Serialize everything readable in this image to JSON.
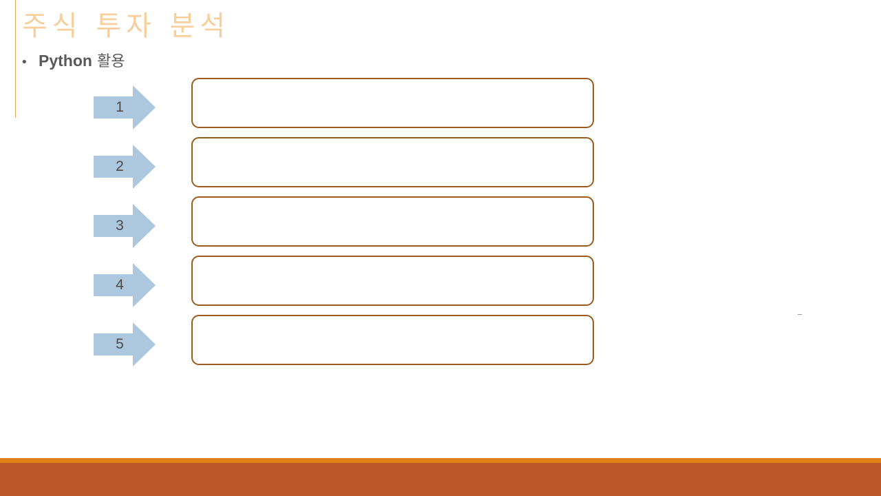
{
  "slide": {
    "title": "주식 투자 분석",
    "bullet": {
      "marker": "•",
      "bold_text": "Python",
      "rest_text": "활용"
    }
  },
  "steps": [
    {
      "number": "1",
      "text": ""
    },
    {
      "number": "2",
      "text": ""
    },
    {
      "number": "3",
      "text": ""
    },
    {
      "number": "4",
      "text": ""
    },
    {
      "number": "5",
      "text": ""
    }
  ],
  "colors": {
    "title": "#f7cf9c",
    "arrow_fill": "#adc7de",
    "box_border": "#9a5b1c",
    "footer_stripe": "#df8215",
    "footer_band": "#bb5728",
    "accent_line": "#e3a15d"
  }
}
